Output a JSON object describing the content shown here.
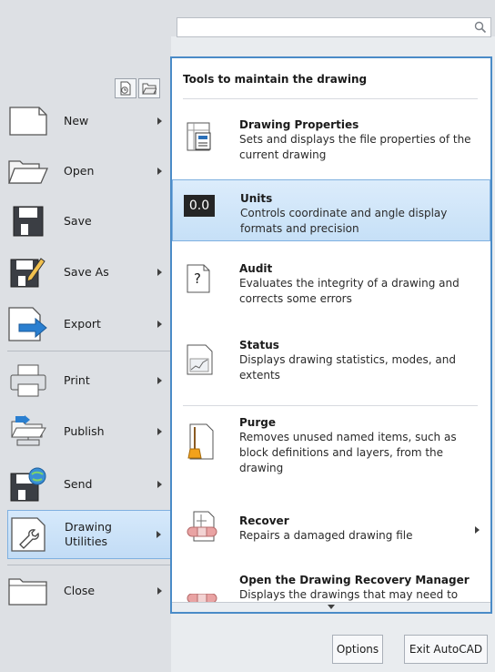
{
  "search": {
    "placeholder": ""
  },
  "menu": {
    "items": [
      {
        "label": "New",
        "icon": "new-document-icon",
        "has_submenu": true
      },
      {
        "label": "Open",
        "icon": "open-folder-icon",
        "has_submenu": true
      },
      {
        "label": "Save",
        "icon": "save-disk-icon",
        "has_submenu": false
      },
      {
        "label": "Save As",
        "icon": "save-as-icon",
        "has_submenu": true
      },
      {
        "label": "Export",
        "icon": "export-icon",
        "has_submenu": true
      },
      {
        "label": "Print",
        "icon": "printer-icon",
        "has_submenu": true
      },
      {
        "label": "Publish",
        "icon": "publish-icon",
        "has_submenu": true
      },
      {
        "label": "Send",
        "icon": "send-icon",
        "has_submenu": true
      },
      {
        "label": "Drawing\nUtilities",
        "icon": "drawing-utilities-icon",
        "has_submenu": true,
        "active": true
      },
      {
        "label": "Close",
        "icon": "close-document-icon",
        "has_submenu": true
      }
    ]
  },
  "flyout": {
    "heading": "Tools to maintain the drawing",
    "items": [
      {
        "title": "Drawing Properties",
        "desc": "Sets and displays the file properties of the current drawing",
        "icon": "drawing-properties-icon"
      },
      {
        "title": "Units",
        "desc": "Controls coordinate and angle display formats and precision",
        "icon": "units-icon",
        "icon_text": "0.0",
        "selected": true
      },
      {
        "title": "Audit",
        "desc": "Evaluates the integrity of a drawing and corrects some errors",
        "icon": "audit-icon",
        "icon_text": "?"
      },
      {
        "title": "Status",
        "desc": "Displays drawing statistics, modes, and extents",
        "icon": "status-icon"
      },
      {
        "title": "Purge",
        "desc": "Removes unused named items, such as block definitions and layers, from the drawing",
        "icon": "purge-icon"
      },
      {
        "title": "Recover",
        "desc": "Repairs a damaged drawing file",
        "icon": "recover-icon",
        "has_submenu": true
      },
      {
        "title": "Open the Drawing Recovery Manager",
        "desc": "Displays the drawings that may need to",
        "icon": "recovery-manager-icon"
      }
    ]
  },
  "footer": {
    "options_label": "Options",
    "exit_label": "Exit AutoCAD"
  },
  "colors": {
    "accent_border": "#4a8bc7",
    "selected_fill": "#c6e0f7",
    "menu_bg": "#dde0e4"
  }
}
